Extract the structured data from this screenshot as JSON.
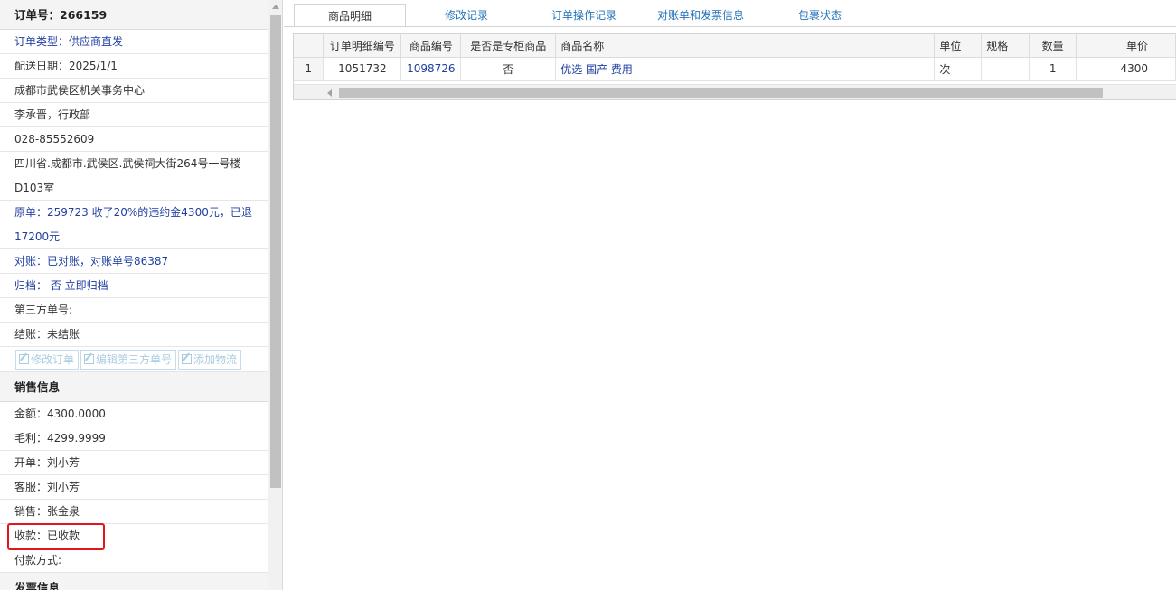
{
  "order": {
    "header": "订单号：266159",
    "type": "订单类型：供应商直发",
    "delivery_date": "配送日期：2025/1/1",
    "org": "成都市武侯区机关事务中心",
    "contact": "李承晋，行政部",
    "phone": "028-85552609",
    "address": "四川省.成都市.武侯区.武侯祠大街264号一号楼D103室",
    "original": "原单：259723 收了20%的违约金4300元，已退17200元",
    "reconcile": "对账：已对账，对账单号86387",
    "archive": "归档： 否 立即归档",
    "third_party": "第三方单号:",
    "settle": "结账：未结账",
    "buttons": [
      "修改订单",
      "编辑第三方单号",
      "添加物流"
    ]
  },
  "sales": {
    "header": "销售信息",
    "amount": "金额：4300.0000",
    "profit": "毛利：4299.9999",
    "opener": "开单：刘小芳",
    "service": "客服：刘小芳",
    "seller": "销售：张金泉",
    "payment": "收款：已收款",
    "pay_method": "付款方式:",
    "next_header": "发票信息"
  },
  "tabs": [
    "商品明细",
    "修改记录",
    "订单操作记录",
    "对账单和发票信息",
    "包裹状态"
  ],
  "grid": {
    "columns": [
      "",
      "订单明细编号",
      "商品编号",
      "是否是专柜商品",
      "商品名称",
      "单位",
      "规格",
      "数量",
      "单价"
    ],
    "rows": [
      [
        "1",
        "1051732",
        "1098726",
        "否",
        "优选 国产 费用",
        "次",
        "",
        "1",
        "4300"
      ]
    ]
  },
  "colors": {
    "link": "#1f3fa0",
    "tab_link": "#2472b8",
    "highlight": "#e3141b"
  }
}
